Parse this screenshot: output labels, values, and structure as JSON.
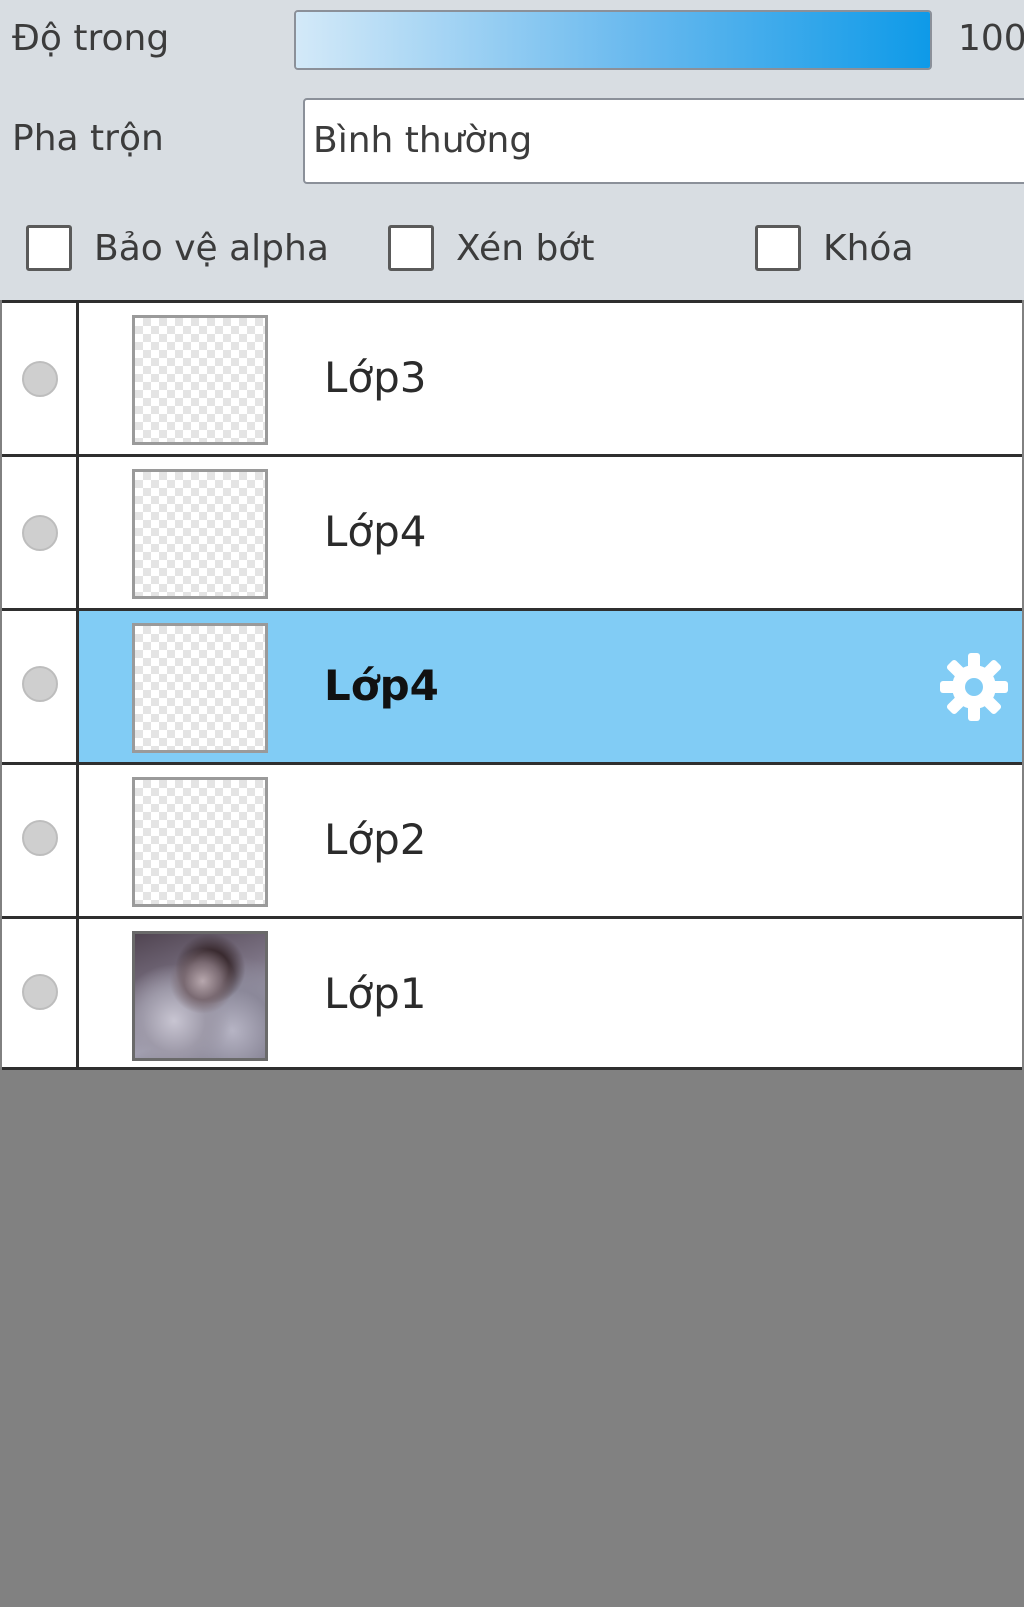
{
  "opacity": {
    "label": "Độ trong",
    "value_text": "100",
    "level": 1.0
  },
  "blend": {
    "label": "Pha trộn",
    "selected": "Bình thường"
  },
  "options": [
    {
      "label": "Bảo vệ alpha",
      "checked": false
    },
    {
      "label": "Xén bớt",
      "checked": false
    },
    {
      "label": "Khóa",
      "checked": false
    }
  ],
  "layers": [
    {
      "name": "Lớp3",
      "selected": false,
      "thumbnail": "transparent"
    },
    {
      "name": "Lớp4",
      "selected": false,
      "thumbnail": "transparent"
    },
    {
      "name": "Lớp4",
      "selected": true,
      "thumbnail": "transparent",
      "icon": "gear-icon"
    },
    {
      "name": "Lớp2",
      "selected": false,
      "thumbnail": "transparent"
    },
    {
      "name": "Lớp1",
      "selected": false,
      "thumbnail": "photo"
    }
  ],
  "colors": {
    "panel_bg": "#d8dde2",
    "selected_row": "#81ccf5",
    "empty_area": "#818181",
    "opacity_accent": "#0e9ae8"
  }
}
